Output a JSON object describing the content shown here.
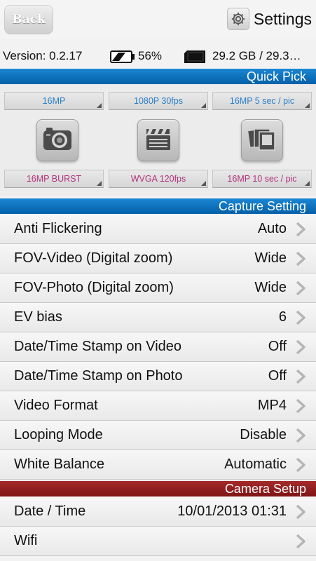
{
  "header": {
    "back_label": "Back",
    "settings_label": "Settings"
  },
  "status": {
    "version": "Version: 0.2.17",
    "battery": "56%",
    "storage": "29.2 GB / 29.3…"
  },
  "quick_pick": {
    "title": "Quick Pick",
    "top_options": [
      "16MP",
      "1080P 30fps",
      "16MP 5 sec / pic"
    ],
    "bottom_options": [
      "16MP BURST",
      "WVGA 120fps",
      "16MP 10 sec / pic"
    ],
    "modes": [
      "camera-icon",
      "clapperboard-icon",
      "photo-stack-icon"
    ]
  },
  "capture": {
    "title": "Capture Setting",
    "rows": [
      {
        "label": "Anti Flickering",
        "value": "Auto"
      },
      {
        "label": "FOV-Video (Digital zoom)",
        "value": "Wide"
      },
      {
        "label": "FOV-Photo (Digital zoom)",
        "value": "Wide"
      },
      {
        "label": "EV bias",
        "value": "6"
      },
      {
        "label": "Date/Time Stamp on Video",
        "value": "Off"
      },
      {
        "label": "Date/Time Stamp on Photo",
        "value": "Off"
      },
      {
        "label": "Video Format",
        "value": "MP4"
      },
      {
        "label": "Looping Mode",
        "value": "Disable"
      },
      {
        "label": "White Balance",
        "value": "Automatic"
      }
    ]
  },
  "camera_setup": {
    "title": "Camera Setup",
    "rows": [
      {
        "label": "Date / Time",
        "value": "10/01/2013 01:31"
      },
      {
        "label": "Wifi",
        "value": ""
      }
    ]
  },
  "colors": {
    "blue_header": "#0a6cbc",
    "red_header": "#8e1c1c",
    "top_option_text": "#2a7fc8",
    "bottom_option_text": "#b0307a"
  }
}
